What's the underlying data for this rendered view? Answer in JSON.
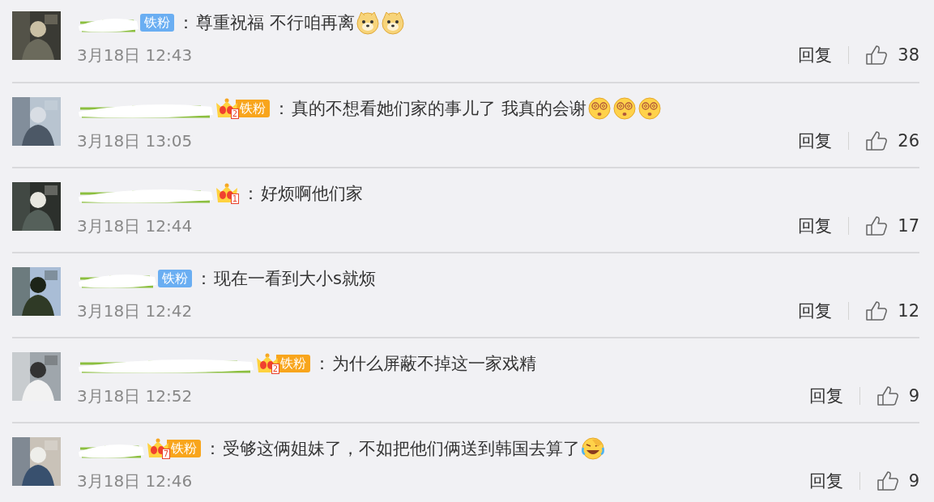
{
  "comments": [
    {
      "avatar": {
        "kind": "picture"
      },
      "badges": [
        {
          "kind": "fan-blue",
          "label": "铁粉"
        }
      ],
      "separator": "：",
      "text": "尊重祝福 不行咱再离",
      "emoji": [
        {
          "kind": "doge"
        },
        {
          "kind": "doge"
        }
      ],
      "time": "3月18日 12:43",
      "reply": "回复",
      "likes": "38"
    },
    {
      "avatar": {
        "kind": "picture"
      },
      "badges": [
        {
          "kind": "crown",
          "level": "2"
        },
        {
          "kind": "fan-gold",
          "label": "铁粉"
        }
      ],
      "separator": "：",
      "text": "真的不想看她们家的事儿了 我真的会谢",
      "emoji": [
        {
          "kind": "dizzy"
        },
        {
          "kind": "dizzy"
        },
        {
          "kind": "dizzy"
        }
      ],
      "time": "3月18日 13:05",
      "reply": "回复",
      "likes": "26"
    },
    {
      "avatar": {
        "kind": "picture"
      },
      "badges": [
        {
          "kind": "crown",
          "level": "1"
        }
      ],
      "separator": "：",
      "text": "好烦啊他们家",
      "time": "3月18日 12:44",
      "reply": "回复",
      "likes": "17"
    },
    {
      "avatar": {
        "kind": "picture"
      },
      "badges": [
        {
          "kind": "fan-blue",
          "label": "铁粉"
        }
      ],
      "separator": "：",
      "text": "现在一看到大小s就烦",
      "time": "3月18日 12:42",
      "reply": "回复",
      "likes": "12"
    },
    {
      "avatar": {
        "kind": "picture"
      },
      "badges": [
        {
          "kind": "crown",
          "level": "2"
        },
        {
          "kind": "fan-gold",
          "label": "铁粉"
        }
      ],
      "separator": "：",
      "text": "为什么屏蔽不掉这一家戏精",
      "time": "3月18日 12:52",
      "reply": "回复",
      "likes": "9"
    },
    {
      "avatar": {
        "kind": "picture"
      },
      "badges": [
        {
          "kind": "crown",
          "level": "7"
        },
        {
          "kind": "fan-gold",
          "label": "铁粉"
        }
      ],
      "separator": "：",
      "text": "受够这俩姐妹了，不如把他们俩送到韩国去算了",
      "emoji": [
        {
          "kind": "laugh-cry"
        }
      ],
      "time": "3月18日 12:46",
      "reply": "回复",
      "likes": "9"
    }
  ]
}
